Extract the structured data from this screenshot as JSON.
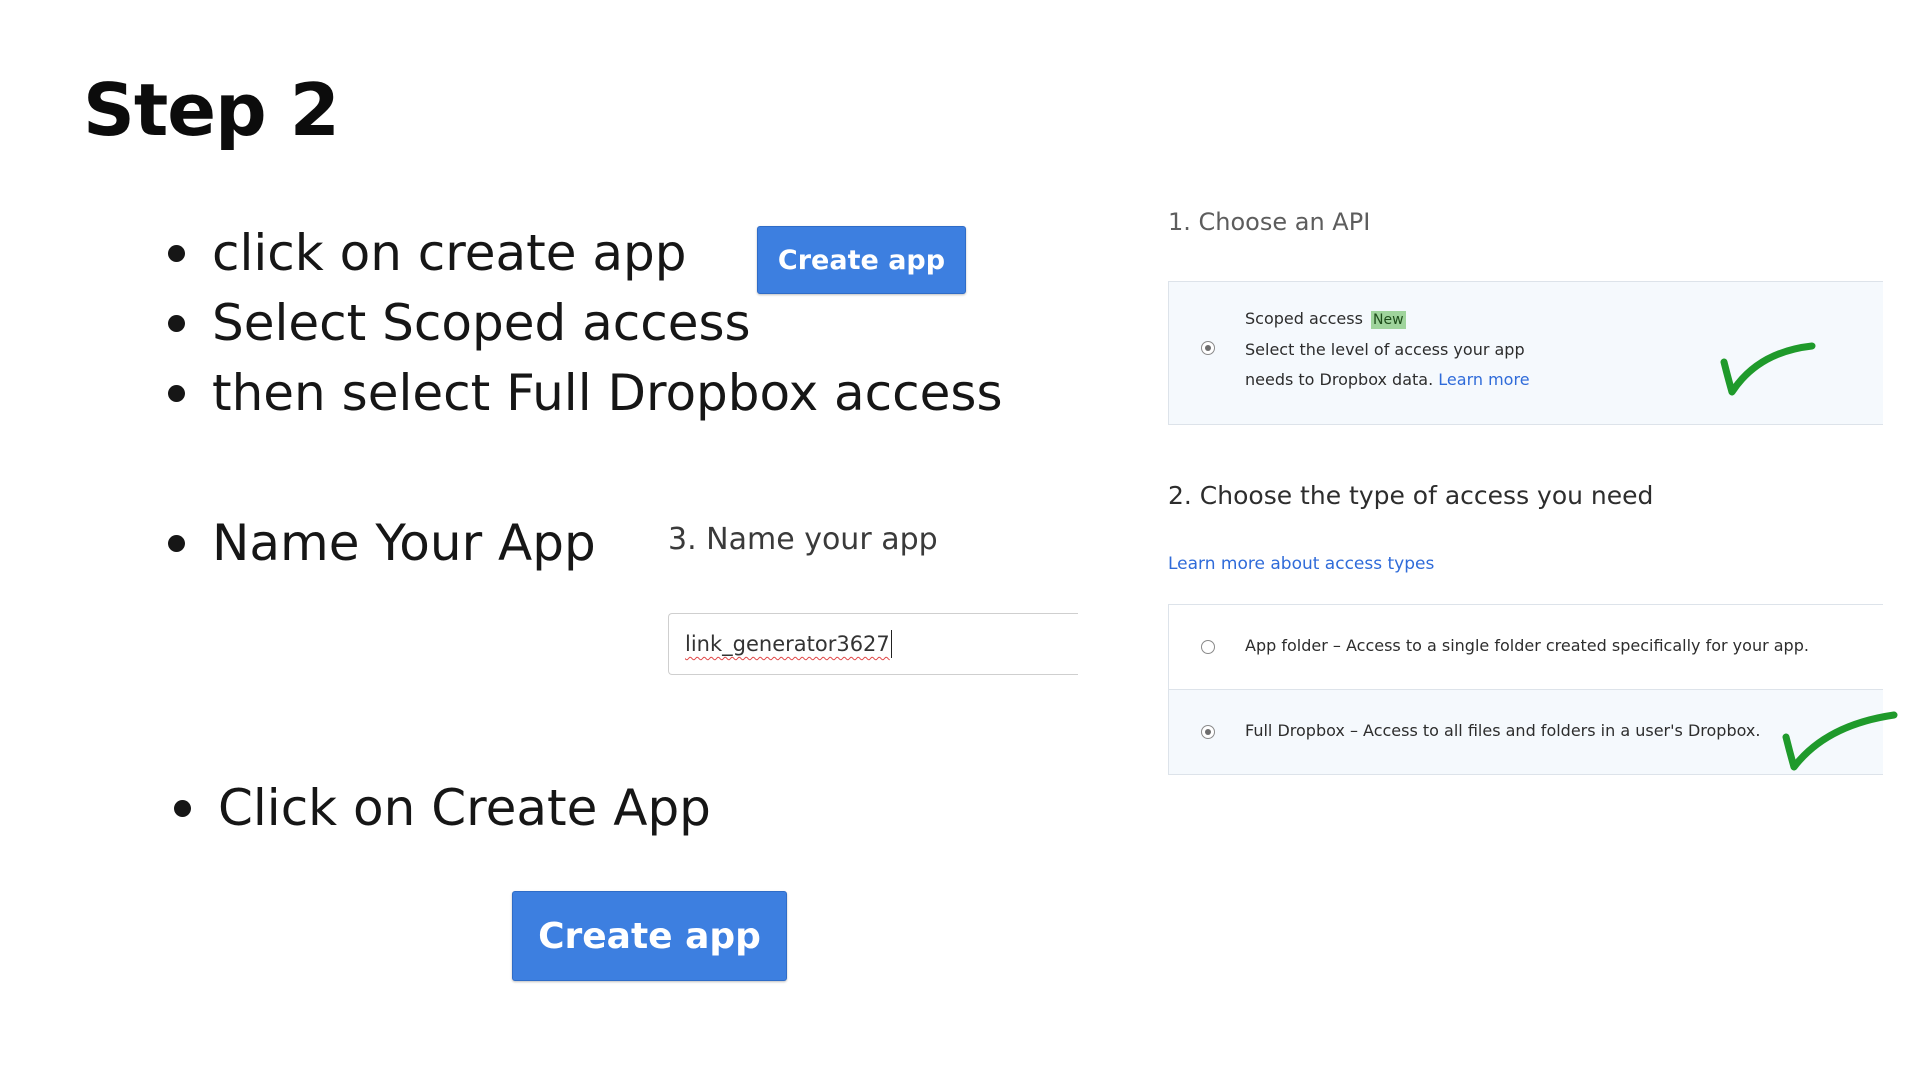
{
  "title": "Step 2",
  "bullets_group1": [
    "click on create app",
    "Select Scoped access",
    "then select Full Dropbox access"
  ],
  "bullets_group2": [
    "Name Your App"
  ],
  "bullets_group3": [
    "Click on Create App"
  ],
  "create_button_label": "Create app",
  "name_app": {
    "label": "3. Name your app",
    "value": "link_generator3627"
  },
  "choose_api": {
    "heading": "1. Choose an API",
    "option_label": "Scoped access",
    "badge": "New",
    "description_line1": "Select the level of access your app",
    "description_line2": "needs to Dropbox data.",
    "learn_more": "Learn more",
    "selected": true
  },
  "access_type": {
    "heading": "2. Choose the type of access you need",
    "learn_more_link": "Learn more about access types",
    "options": [
      {
        "label": "App folder",
        "description": "– Access to a single folder created specifically for your app.",
        "selected": false
      },
      {
        "label": "Full Dropbox",
        "description": "– Access to all files and folders in a user's Dropbox.",
        "selected": true
      }
    ]
  },
  "colors": {
    "button_blue": "#3d7fe0",
    "link_blue": "#2f6bd9",
    "check_green": "#1f9a2b",
    "badge_green": "#9fd49c",
    "panel_highlight": "#f5f9fd"
  },
  "icons": [
    "checkmark-icon",
    "radio-button"
  ]
}
